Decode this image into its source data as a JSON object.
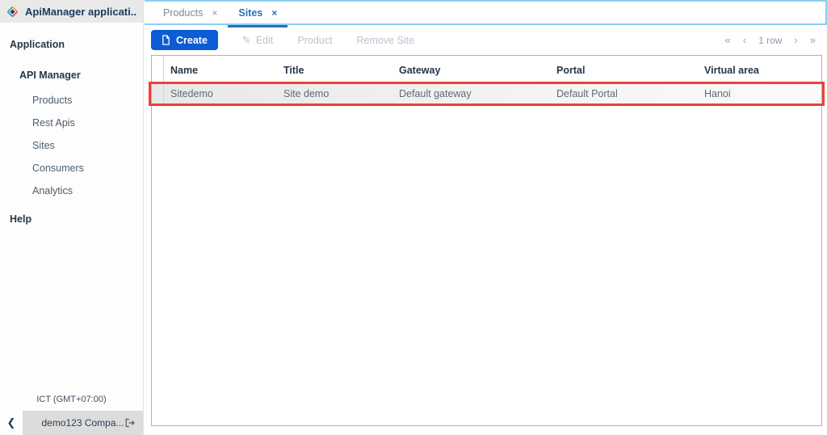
{
  "colors": {
    "accent_blue": "#0b5cd5",
    "active_tab_blue": "#2e6db4",
    "highlight_red": "#e8433c",
    "tabbar_border_blue": "#8bcff3",
    "table_border": "#a7b4c2",
    "sidebar_header_bg": "#e9e9e9",
    "footer_bar_bg": "#dcdcdc"
  },
  "sidebar": {
    "title": "ApiManager applicati...",
    "section_application": "Application",
    "group_api_manager": "API Manager",
    "items": [
      {
        "label": "Products"
      },
      {
        "label": "Rest Apis"
      },
      {
        "label": "Sites"
      },
      {
        "label": "Consumers"
      },
      {
        "label": "Analytics"
      }
    ],
    "section_help": "Help",
    "timezone": "ICT (GMT+07:00)",
    "footer": {
      "collapse_icon": "❮",
      "company": "demo123 Compa..."
    }
  },
  "tabs": [
    {
      "label": "Products",
      "close": "×"
    },
    {
      "label": "Sites",
      "close": "×"
    }
  ],
  "toolbar": {
    "create": "Create",
    "edit": "Edit",
    "edit_icon": "✎",
    "product": "Product",
    "remove_site": "Remove Site"
  },
  "pagination": {
    "first": "«",
    "prev": "‹",
    "label": "1 row",
    "next": "›",
    "last": "»"
  },
  "table": {
    "columns": [
      "Name",
      "Title",
      "Gateway",
      "Portal",
      "Virtual area"
    ],
    "rows": [
      {
        "name": "Sitedemo",
        "title": "Site demo",
        "gateway": "Default gateway",
        "portal": "Default Portal",
        "virtual_area": "Hanoi"
      }
    ]
  }
}
